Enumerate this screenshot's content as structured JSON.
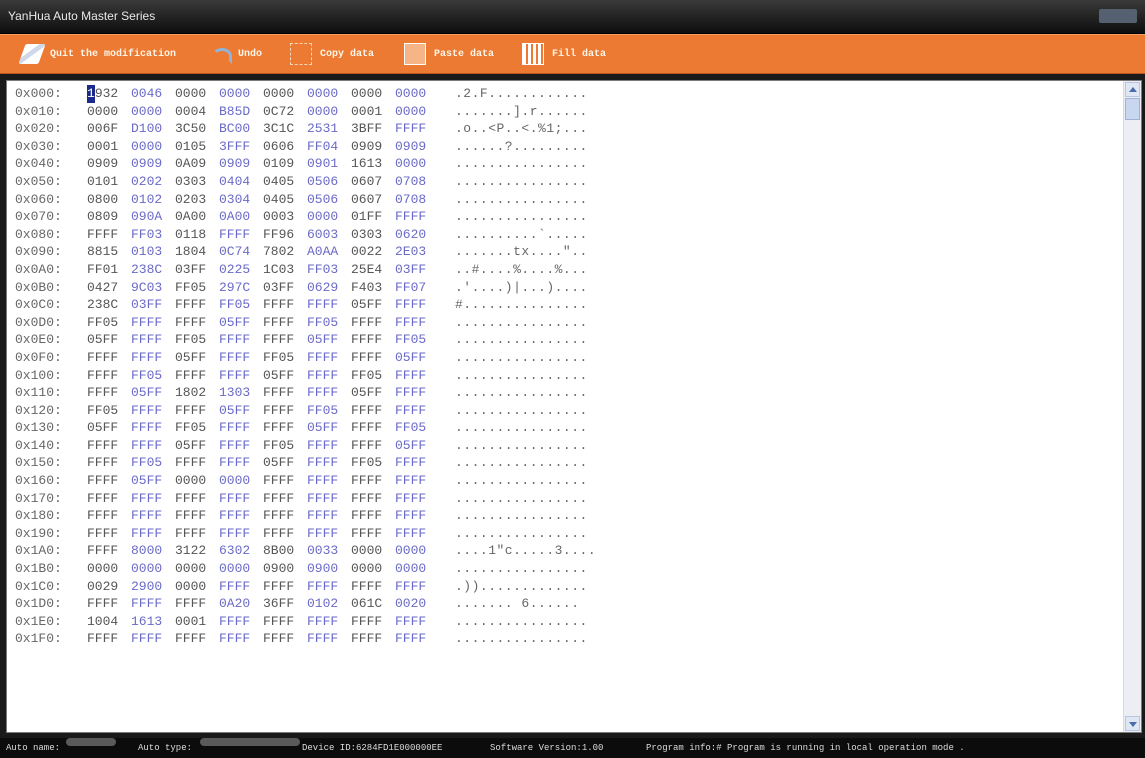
{
  "window": {
    "title": "YanHua Auto Master Series"
  },
  "toolbar": {
    "quit_label": "Quit the modification",
    "undo_label": "Undo",
    "copy_label": "Copy data",
    "paste_label": "Paste data",
    "fill_label": "Fill data"
  },
  "hex": {
    "rows": [
      {
        "addr": "0x000:",
        "words": [
          "1932",
          "0046",
          "0000",
          "0000",
          "0000",
          "0000",
          "0000",
          "0000"
        ],
        "ascii": ".2.F............"
      },
      {
        "addr": "0x010:",
        "words": [
          "0000",
          "0000",
          "0004",
          "B85D",
          "0C72",
          "0000",
          "0001",
          "0000"
        ],
        "ascii": ".......].r......"
      },
      {
        "addr": "0x020:",
        "words": [
          "006F",
          "D100",
          "3C50",
          "BC00",
          "3C1C",
          "2531",
          "3BFF",
          "FFFF"
        ],
        "ascii": ".o..<P..<.%1;..."
      },
      {
        "addr": "0x030:",
        "words": [
          "0001",
          "0000",
          "0105",
          "3FFF",
          "0606",
          "FF04",
          "0909",
          "0909"
        ],
        "ascii": "......?........."
      },
      {
        "addr": "0x040:",
        "words": [
          "0909",
          "0909",
          "0A09",
          "0909",
          "0109",
          "0901",
          "1613",
          "0000"
        ],
        "ascii": "................"
      },
      {
        "addr": "0x050:",
        "words": [
          "0101",
          "0202",
          "0303",
          "0404",
          "0405",
          "0506",
          "0607",
          "0708"
        ],
        "ascii": "................"
      },
      {
        "addr": "0x060:",
        "words": [
          "0800",
          "0102",
          "0203",
          "0304",
          "0405",
          "0506",
          "0607",
          "0708"
        ],
        "ascii": "................"
      },
      {
        "addr": "0x070:",
        "words": [
          "0809",
          "090A",
          "0A00",
          "0A00",
          "0003",
          "0000",
          "01FF",
          "FFFF"
        ],
        "ascii": "................"
      },
      {
        "addr": "0x080:",
        "words": [
          "FFFF",
          "FF03",
          "0118",
          "FFFF",
          "FF96",
          "6003",
          "0303",
          "0620"
        ],
        "ascii": "..........`....."
      },
      {
        "addr": "0x090:",
        "words": [
          "8815",
          "0103",
          "1804",
          "0C74",
          "7802",
          "A0AA",
          "0022",
          "2E03"
        ],
        "ascii": ".......tx....\".."
      },
      {
        "addr": "0x0A0:",
        "words": [
          "FF01",
          "238C",
          "03FF",
          "0225",
          "1C03",
          "FF03",
          "25E4",
          "03FF"
        ],
        "ascii": "..#....%....%..."
      },
      {
        "addr": "0x0B0:",
        "words": [
          "0427",
          "9C03",
          "FF05",
          "297C",
          "03FF",
          "0629",
          "F403",
          "FF07"
        ],
        "ascii": ".'....)|...)...."
      },
      {
        "addr": "0x0C0:",
        "words": [
          "238C",
          "03FF",
          "FFFF",
          "FF05",
          "FFFF",
          "FFFF",
          "05FF",
          "FFFF"
        ],
        "ascii": "#..............."
      },
      {
        "addr": "0x0D0:",
        "words": [
          "FF05",
          "FFFF",
          "FFFF",
          "05FF",
          "FFFF",
          "FF05",
          "FFFF",
          "FFFF"
        ],
        "ascii": "................"
      },
      {
        "addr": "0x0E0:",
        "words": [
          "05FF",
          "FFFF",
          "FF05",
          "FFFF",
          "FFFF",
          "05FF",
          "FFFF",
          "FF05"
        ],
        "ascii": "................"
      },
      {
        "addr": "0x0F0:",
        "words": [
          "FFFF",
          "FFFF",
          "05FF",
          "FFFF",
          "FF05",
          "FFFF",
          "FFFF",
          "05FF"
        ],
        "ascii": "................"
      },
      {
        "addr": "0x100:",
        "words": [
          "FFFF",
          "FF05",
          "FFFF",
          "FFFF",
          "05FF",
          "FFFF",
          "FF05",
          "FFFF"
        ],
        "ascii": "................"
      },
      {
        "addr": "0x110:",
        "words": [
          "FFFF",
          "05FF",
          "1802",
          "1303",
          "FFFF",
          "FFFF",
          "05FF",
          "FFFF"
        ],
        "ascii": "................"
      },
      {
        "addr": "0x120:",
        "words": [
          "FF05",
          "FFFF",
          "FFFF",
          "05FF",
          "FFFF",
          "FF05",
          "FFFF",
          "FFFF"
        ],
        "ascii": "................"
      },
      {
        "addr": "0x130:",
        "words": [
          "05FF",
          "FFFF",
          "FF05",
          "FFFF",
          "FFFF",
          "05FF",
          "FFFF",
          "FF05"
        ],
        "ascii": "................"
      },
      {
        "addr": "0x140:",
        "words": [
          "FFFF",
          "FFFF",
          "05FF",
          "FFFF",
          "FF05",
          "FFFF",
          "FFFF",
          "05FF"
        ],
        "ascii": "................"
      },
      {
        "addr": "0x150:",
        "words": [
          "FFFF",
          "FF05",
          "FFFF",
          "FFFF",
          "05FF",
          "FFFF",
          "FF05",
          "FFFF"
        ],
        "ascii": "................"
      },
      {
        "addr": "0x160:",
        "words": [
          "FFFF",
          "05FF",
          "0000",
          "0000",
          "FFFF",
          "FFFF",
          "FFFF",
          "FFFF"
        ],
        "ascii": "................"
      },
      {
        "addr": "0x170:",
        "words": [
          "FFFF",
          "FFFF",
          "FFFF",
          "FFFF",
          "FFFF",
          "FFFF",
          "FFFF",
          "FFFF"
        ],
        "ascii": "................"
      },
      {
        "addr": "0x180:",
        "words": [
          "FFFF",
          "FFFF",
          "FFFF",
          "FFFF",
          "FFFF",
          "FFFF",
          "FFFF",
          "FFFF"
        ],
        "ascii": "................"
      },
      {
        "addr": "0x190:",
        "words": [
          "FFFF",
          "FFFF",
          "FFFF",
          "FFFF",
          "FFFF",
          "FFFF",
          "FFFF",
          "FFFF"
        ],
        "ascii": "................"
      },
      {
        "addr": "0x1A0:",
        "words": [
          "FFFF",
          "8000",
          "3122",
          "6302",
          "8B00",
          "0033",
          "0000",
          "0000"
        ],
        "ascii": "....1\"c.....3...."
      },
      {
        "addr": "0x1B0:",
        "words": [
          "0000",
          "0000",
          "0000",
          "0000",
          "0900",
          "0900",
          "0000",
          "0000"
        ],
        "ascii": "................"
      },
      {
        "addr": "0x1C0:",
        "words": [
          "0029",
          "2900",
          "0000",
          "FFFF",
          "FFFF",
          "FFFF",
          "FFFF",
          "FFFF"
        ],
        "ascii": ".))............."
      },
      {
        "addr": "0x1D0:",
        "words": [
          "FFFF",
          "FFFF",
          "FFFF",
          "0A20",
          "36FF",
          "0102",
          "061C",
          "0020"
        ],
        "ascii": "....... 6......"
      },
      {
        "addr": "0x1E0:",
        "words": [
          "1004",
          "1613",
          "0001",
          "FFFF",
          "FFFF",
          "FFFF",
          "FFFF",
          "FFFF"
        ],
        "ascii": "................"
      },
      {
        "addr": "0x1F0:",
        "words": [
          "FFFF",
          "FFFF",
          "FFFF",
          "FFFF",
          "FFFF",
          "FFFF",
          "FFFF",
          "FFFF"
        ],
        "ascii": "................"
      }
    ]
  },
  "status": {
    "auto_name_label": "Auto name:",
    "auto_type_label": "Auto type:",
    "device_id": "Device ID:6284FD1E000000EE",
    "software_version": "Software Version:1.00",
    "program_info": "Program info:# Program is running in local operation mode ."
  }
}
